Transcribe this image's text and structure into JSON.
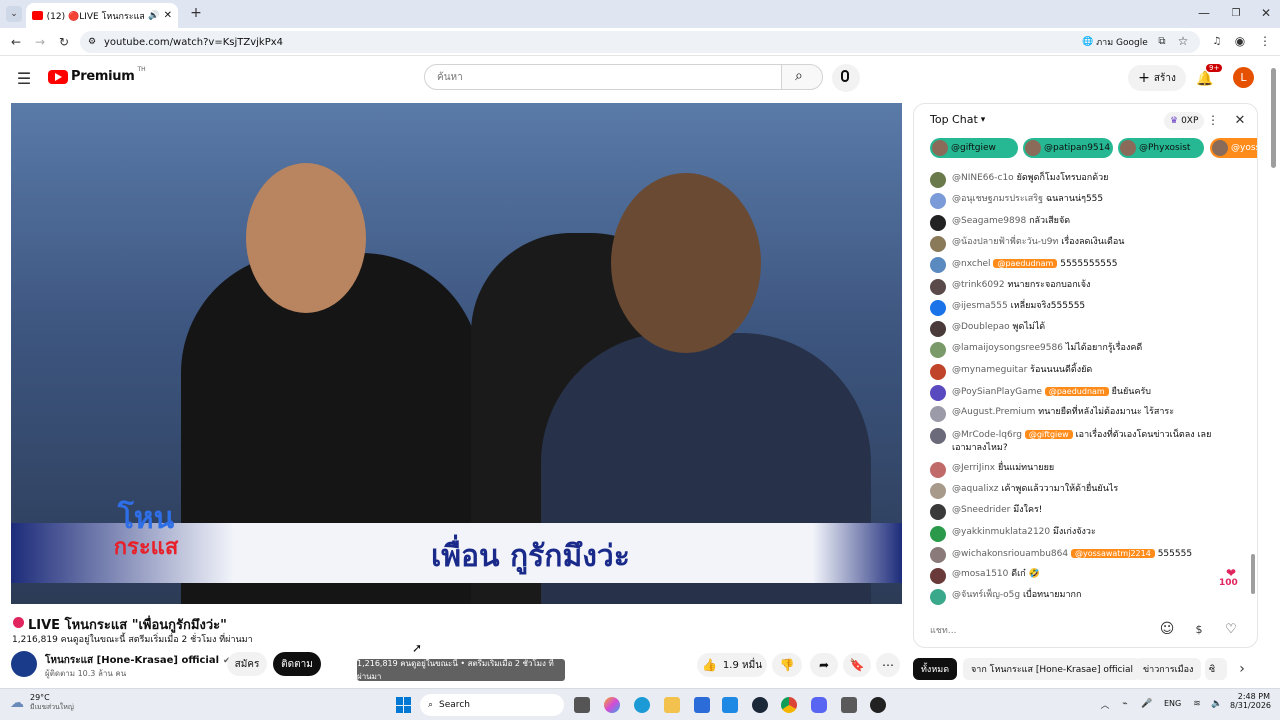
{
  "browser": {
    "tab_title": "(12) 🔴LIVE โหนกระแส \"เพื่อน",
    "url": "youtube.com/watch?v=KsjTZvjkPx4",
    "translate_label": "ภาม Google"
  },
  "header": {
    "logo_text": "Premium",
    "logo_sup": "TH",
    "search_placeholder": "ค้นหา",
    "create_label": "สร้าง",
    "notif_count": "9+",
    "avatar_letter": "L"
  },
  "video": {
    "caption_big": "เพื่อน กูรักมึงว่ะ",
    "logo_line1": "โหน",
    "logo_line2": "กระแส"
  },
  "info": {
    "title": "LIVE โหนกระแส \"เพื่อนกูรักมึงว่ะ\"",
    "meta": "1,216,819 คนดูอยู่ในขณะนี้  สตรีมเริ่มเมื่อ 2 ชั่วโมง ที่ผ่านมา",
    "channel_name": "โหนกระแส [Hone-Krasae] official",
    "subscribers": "ผู้ติดตาม 10.3 ล้าน คน",
    "member_label": "สมัคร",
    "subscribe_label": "ติดตาม",
    "like_count": "1.9 หมื่น",
    "tooltip": "1,216,819 คนดูอยู่ในขณะนี้ • สตรีมเริ่มเมื่อ 2 ชั่วโมง ที่ผ่านมา"
  },
  "chat": {
    "header": "Top Chat",
    "xp": "0XP",
    "pinned": [
      "@giftgiew",
      "@patipan9514",
      "@Phyxosist",
      "@yoss"
    ],
    "input_placeholder": "แชท...",
    "messages": [
      {
        "author": "@NINE66-c1o",
        "text": "ยัดพูดก็โมงโทรบอกด้วย",
        "color": "#6a7a4a"
      },
      {
        "author": "@อนุเชษฐภมรประเสริฐ",
        "text": "ฉนลานน่ๆ555",
        "color": "#7a9ad8"
      },
      {
        "author": "@Seagame9898",
        "text": "กลัวเสียจัด",
        "color": "#222222"
      },
      {
        "author": "@น้องปลายฟ้าพี่ตะวัน-บ9ท",
        "text": "เรื่องลดเงินเดือน",
        "color": "#8a7a5a"
      },
      {
        "author": "@nxchel",
        "mention": "@paedudnam",
        "text": "5555555555",
        "color": "#5a8ac0"
      },
      {
        "author": "@trink6092",
        "text": "ทนายกระจอกบอกเจ้ง",
        "color": "#5a4a4a"
      },
      {
        "author": "@ijesma555",
        "text": "เหลี่ยมจริง555555",
        "color": "#1a73e8"
      },
      {
        "author": "@Doublepao",
        "text": "พูดไม่ได้",
        "color": "#4a3a3a"
      },
      {
        "author": "@lamaijoysongsree9586",
        "text": "ไม่ได้อยากรู้เรื่องคดี",
        "color": "#7a9a6a"
      },
      {
        "author": "@mynameguitar",
        "text": "ร้อนนนนดีดิ้งยัด",
        "color": "#c0442a"
      },
      {
        "author": "@PoySianPlayGame",
        "mention": "@paedudnam",
        "text": "ยืนยันครับ",
        "color": "#5a4ac0"
      },
      {
        "author": "@August.Premium",
        "text": "ทนายยืดที่หลังไม่ต้องมานะ ไร้สาระ",
        "color": "#9a9aa8"
      },
      {
        "author": "@MrCode-lq6rg",
        "mention": "@giftgiew",
        "text": "เอาเรื่องที่ตัวเองโดนข่าวเน็ตลง เลย",
        "text2": "เอามาลงไหม?",
        "color": "#6a6a7a"
      },
      {
        "author": "@JerriJinx",
        "text": "ยื่นแม่ทนายยย",
        "color": "#c06a6a"
      },
      {
        "author": "@aqualixz",
        "text": "เค้าพูดแล้ววามาให้ด้ายื่นยันไร",
        "color": "#a89a8a"
      },
      {
        "author": "@Sneedrider",
        "text": "มึงใคร!",
        "color": "#3a3a3a"
      },
      {
        "author": "@yakkinmuklata2120",
        "text": "มึงเก่งจังวะ",
        "color": "#2a9a4a"
      },
      {
        "author": "@wichakonsriouambu864",
        "mention": "@yossawatmj2214",
        "text": "555555",
        "color": "#8a7a7a"
      },
      {
        "author": "@mosa1510",
        "text": "ดีเก๋ 🤣",
        "color": "#6a3a3a"
      },
      {
        "author": "@จันทร์เพ็ญ-o5g",
        "text": "เบื่อทนายมากก",
        "color": "#3aa88a"
      }
    ]
  },
  "chips": [
    "ทั้งหมด",
    "จาก โหนกระแส [Hone-Krasae] official",
    "ข่าวการเมือง",
    "ซิ"
  ],
  "taskbar": {
    "weather_temp": "29°C",
    "weather_desc": "มีเมฆส่วนใหญ่",
    "search_label": "Search",
    "lang": "ENG",
    "time": "2:48 PM",
    "date": "8/31/2026"
  }
}
